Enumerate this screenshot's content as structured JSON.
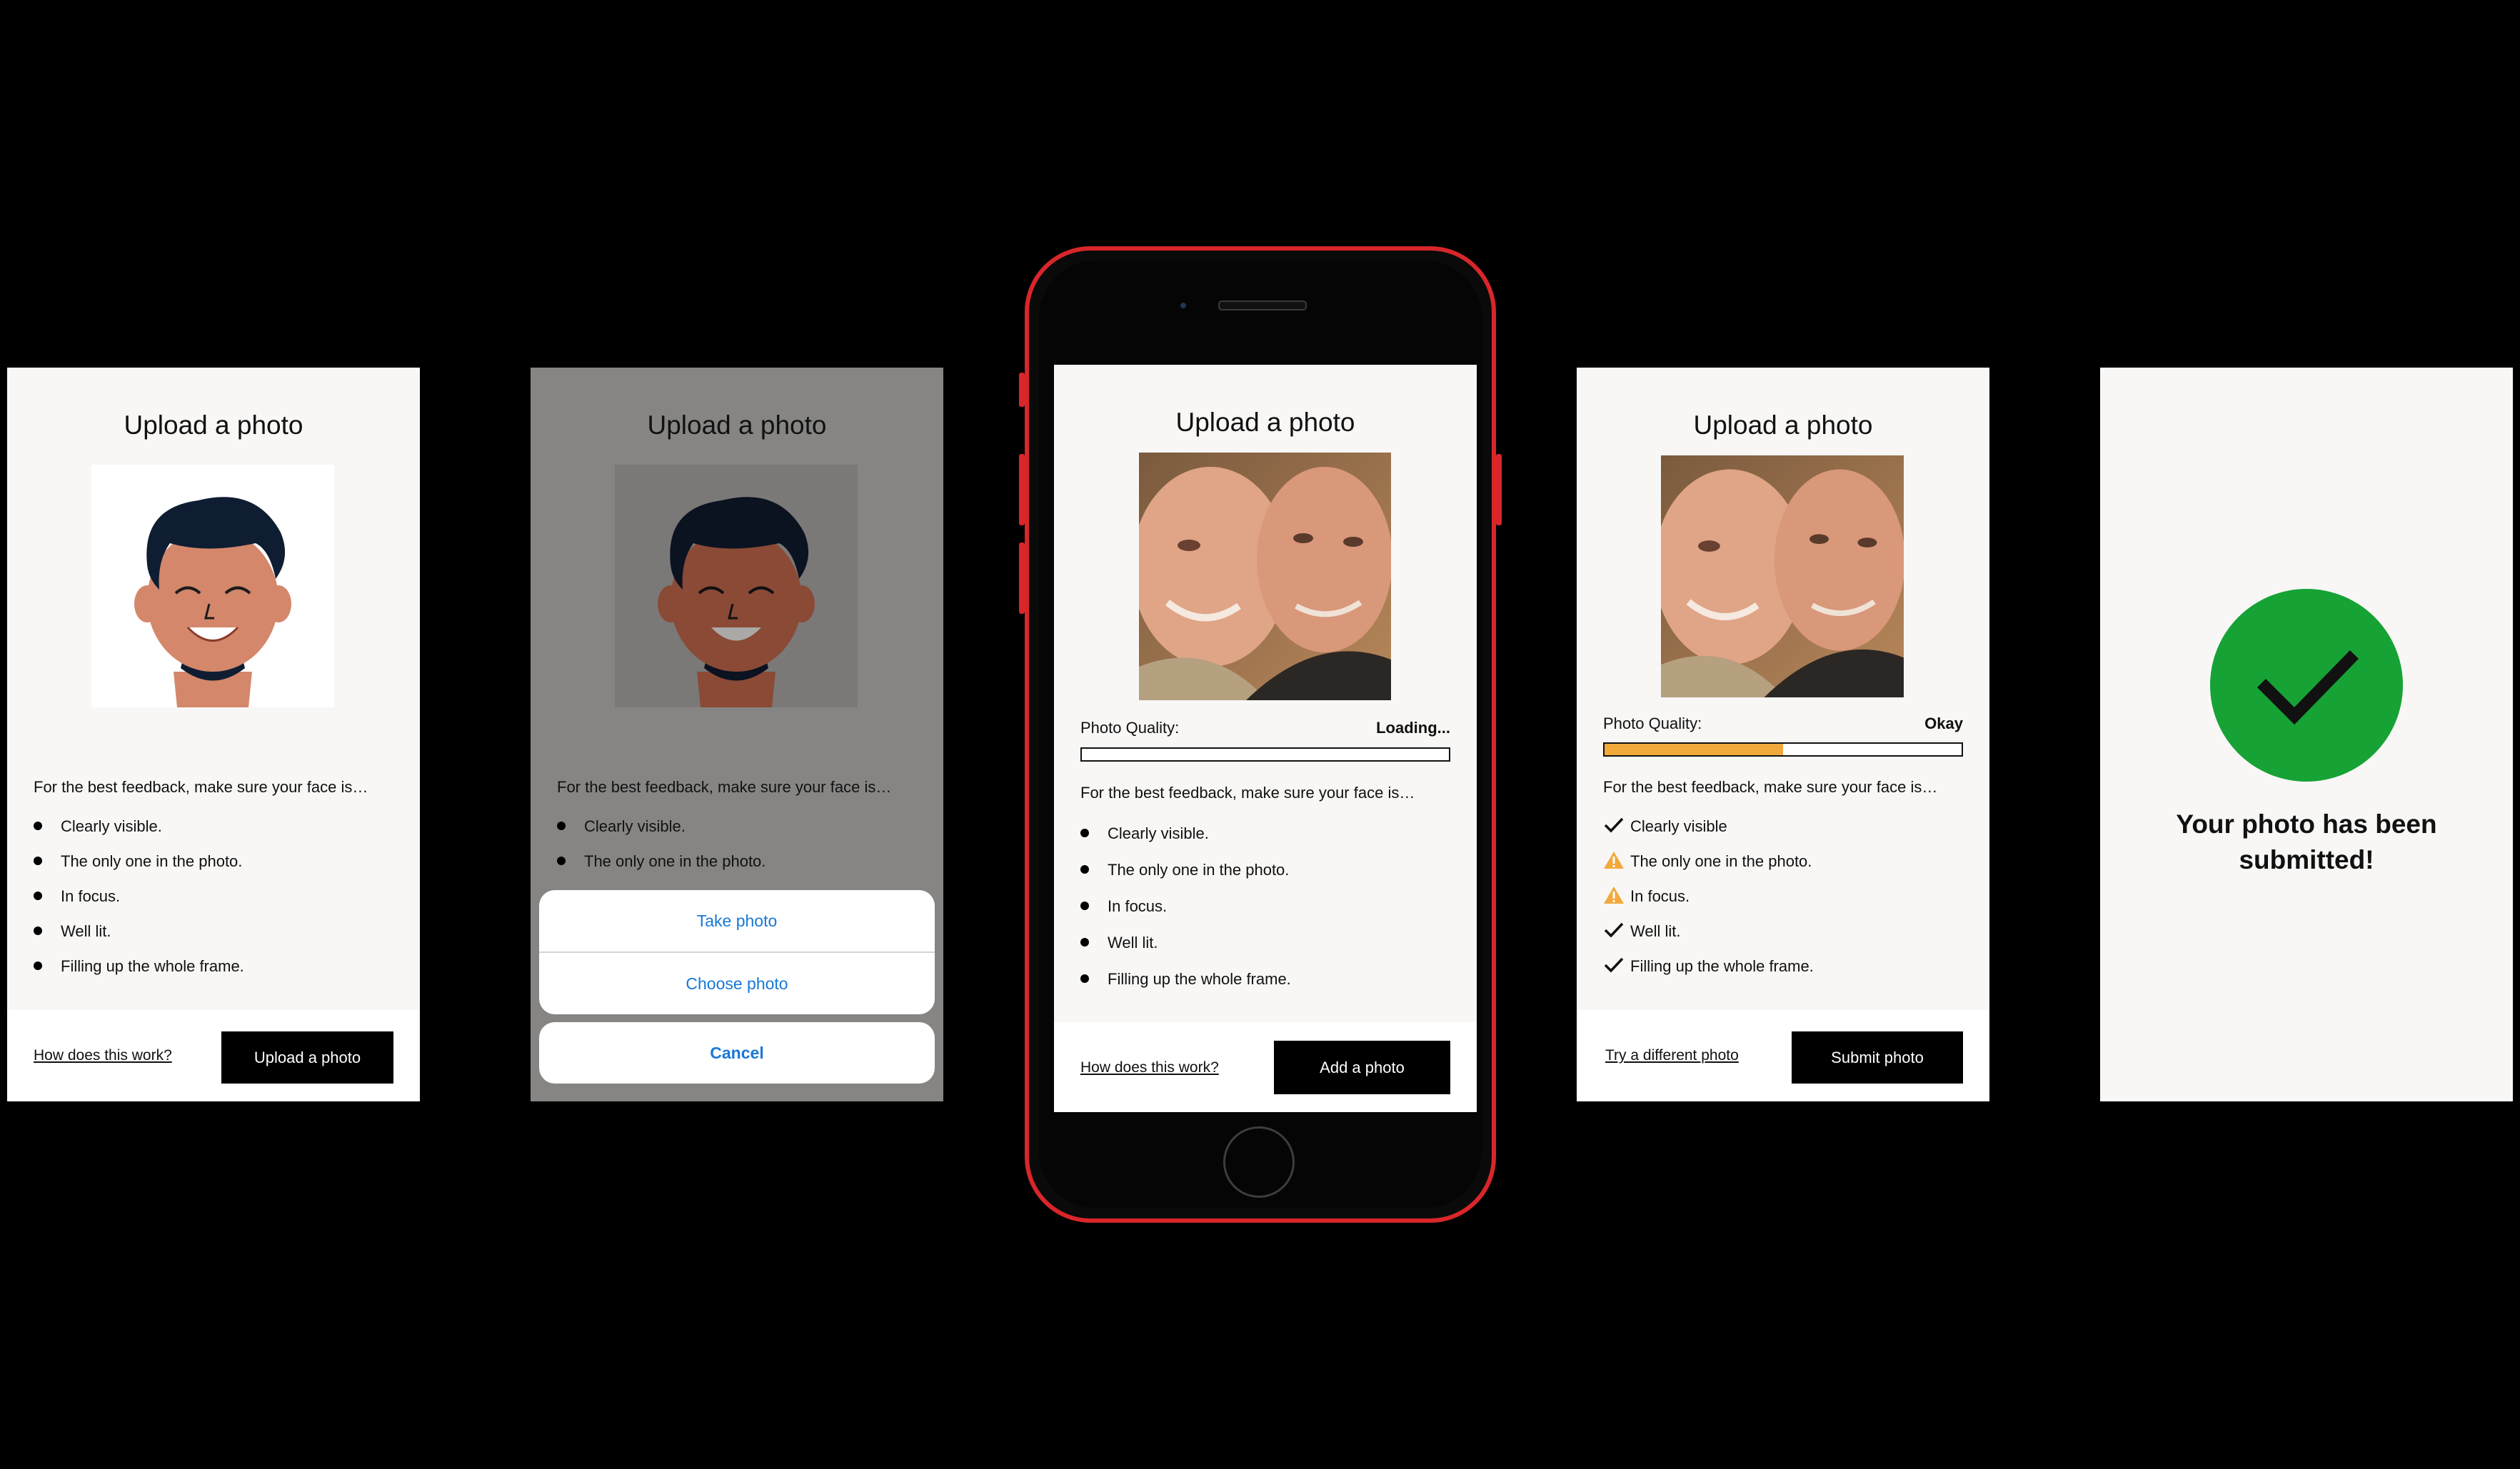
{
  "screens": {
    "s1": {
      "title": "Upload a photo",
      "intro": "For the best feedback, make sure your face is…",
      "checklist": [
        "Clearly visible.",
        "The only one in the photo.",
        "In focus.",
        "Well lit.",
        "Filling up the whole frame."
      ],
      "link": "How does this work?",
      "button": "Upload a photo"
    },
    "s2": {
      "title": "Upload a photo",
      "intro": "For the best feedback, make sure your face is…",
      "checklist": [
        "Clearly visible.",
        "The only one in the photo."
      ],
      "sheet": {
        "take": "Take photo",
        "choose": "Choose photo",
        "cancel": "Cancel"
      }
    },
    "s3": {
      "title": "Upload a photo",
      "quality_label": "Photo Quality:",
      "quality_value": "Loading...",
      "quality_level": 0,
      "intro": "For the best feedback, make sure your face is…",
      "checklist": [
        "Clearly visible.",
        "The only one in the photo.",
        "In focus.",
        "Well lit.",
        "Filling up the whole frame."
      ],
      "link": "How does this work?",
      "button": "Add a photo"
    },
    "s4": {
      "title": "Upload a photo",
      "quality_label": "Photo Quality:",
      "quality_value": "Okay",
      "quality_level": 0.5,
      "intro": "For the best feedback, make sure your face is…",
      "checklist": [
        {
          "text": "Clearly visible",
          "status": "check"
        },
        {
          "text": "The only one in the photo.",
          "status": "warning"
        },
        {
          "text": "In focus.",
          "status": "warning"
        },
        {
          "text": "Well lit.",
          "status": "check"
        },
        {
          "text": "Filling up the whole frame.",
          "status": "check"
        }
      ],
      "link": "Try a different photo",
      "button": "Submit photo"
    },
    "s5": {
      "message_line1": "Your photo has been",
      "message_line2": "submitted!"
    }
  },
  "icons": {
    "avatar": "smiling-avatar-illustration",
    "photo": "two-faces-selfie-photo",
    "check": "check-icon",
    "warning": "warning-icon",
    "success": "checkmark-circle-icon"
  },
  "colors": {
    "success": "#16a235",
    "warning": "#f2a93b",
    "link_blue": "#1878d6",
    "phone_frame": "#d9262a"
  }
}
